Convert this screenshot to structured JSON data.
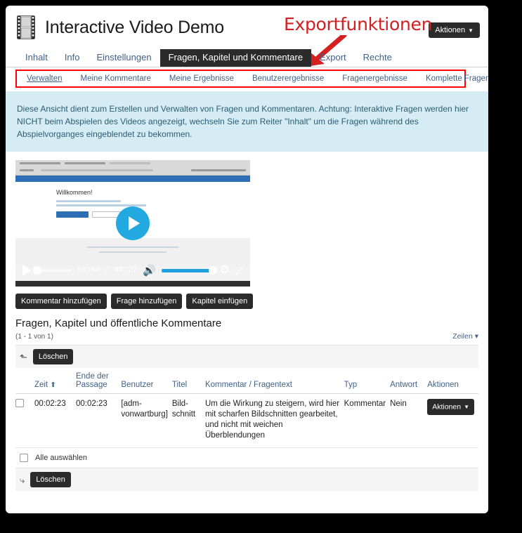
{
  "header": {
    "title": "Interactive Video Demo",
    "icon": "film-strip-icon",
    "actions_label": "Aktionen",
    "caret": "▾"
  },
  "annotation": {
    "text": "Exportfunktionen",
    "color": "#d42020"
  },
  "tabs": [
    {
      "label": "Inhalt",
      "active": false
    },
    {
      "label": "Info",
      "active": false
    },
    {
      "label": "Einstellungen",
      "active": false
    },
    {
      "label": "Fragen, Kapitel und Kommentare",
      "active": true
    },
    {
      "label": "Export",
      "active": false
    },
    {
      "label": "Rechte",
      "active": false
    }
  ],
  "subnav": {
    "highlight_color": "#ff0000",
    "items": [
      {
        "label": "Verwalten",
        "active": true
      },
      {
        "label": "Meine Kommentare",
        "active": false
      },
      {
        "label": "Meine Ergebnisse",
        "active": false
      },
      {
        "label": "Benutzerergebnisse",
        "active": false
      },
      {
        "label": "Fragenergebnisse",
        "active": false
      },
      {
        "label": "Komplette Fragenergebnisse",
        "active": false
      }
    ]
  },
  "infobox": {
    "text": "Diese Ansicht dient zum Erstellen und Verwalten von Fragen und Kommentaren. Achtung: Interaktive Fragen werden hier NICHT beim Abspielen des Videos angezeigt, wechseln Sie zum Reiter \"Inhalt\" um die Fragen während des Abspielvorganges eingeblendet zu bekommen.",
    "background": "#d5ecf5"
  },
  "video": {
    "poster_heading": "Willkommen!",
    "current_time": "00:00",
    "separator": "/",
    "duration": "04:27",
    "time_display": "00:00 / 04:27",
    "play_icon": "play-icon",
    "volume_icon": "volume-icon",
    "settings_icon": "gear-icon",
    "fullscreen_icon": "fullscreen-icon",
    "accent": "#22a9e0"
  },
  "action_buttons": [
    {
      "label": "Kommentar hinzufügen"
    },
    {
      "label": "Frage hinzufügen"
    },
    {
      "label": "Kapitel einfügen"
    }
  ],
  "table_section": {
    "title": "Fragen, Kapitel und öffentliche Kommentare",
    "count": "(1 - 1 von 1)",
    "rows_link": "Zeilen",
    "rows_caret": "▾",
    "delete_top_label": "Löschen",
    "delete_bottom_label": "Löschen",
    "select_all_label": "Alle auswählen",
    "columns": [
      {
        "label": ""
      },
      {
        "label": "Zeit",
        "sorted": "⬆"
      },
      {
        "label": "Ende der Passage"
      },
      {
        "label": "Benutzer"
      },
      {
        "label": "Titel"
      },
      {
        "label": "Kommentar / Fragentext"
      },
      {
        "label": "Typ"
      },
      {
        "label": "Antwort"
      },
      {
        "label": "Aktionen"
      }
    ],
    "rows": [
      {
        "zeit": "00:02:23",
        "ende": "00:02:23",
        "benutzer": "[adm-vonwartburg]",
        "titel": "Bild-schnitt",
        "kommentar": "Um die Wirkung zu steigern, wird hier mit scharfen Bildschnitten gearbeitet, und nicht mit weichen Überblendungen",
        "typ": "Kommentar",
        "antwort": "Nein",
        "actions_label": "Aktionen"
      }
    ]
  }
}
